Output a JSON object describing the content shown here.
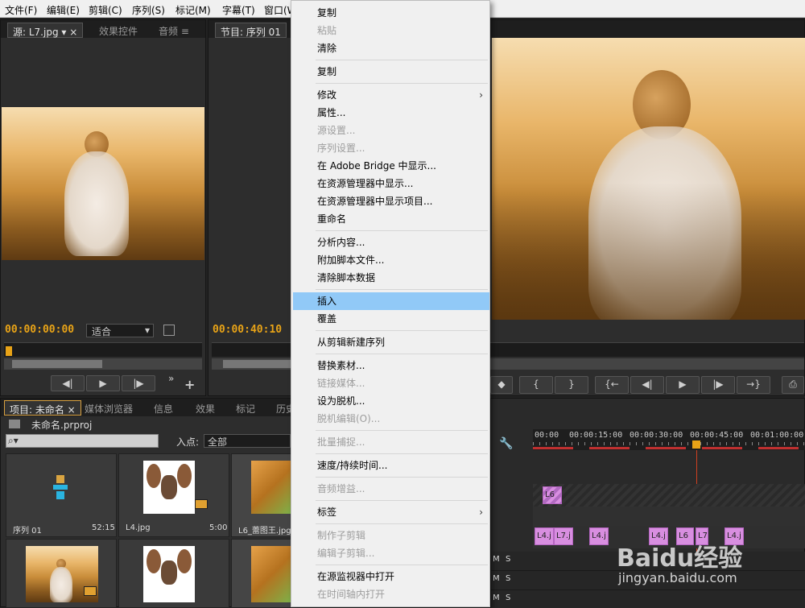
{
  "menubar": {
    "items": [
      "文件(F)",
      "编辑(E)",
      "剪辑(C)",
      "序列(S)",
      "标记(M)",
      "字幕(T)",
      "窗口(W"
    ]
  },
  "source_panel": {
    "tab_source": "源: L7.jpg",
    "tab_effects": "效果控件",
    "tab_audio": "音频",
    "timecode": "00:00:00:00",
    "fit": "适合"
  },
  "program_panel": {
    "tab": "节目: 序列 01",
    "timecode": "00:00:40:10",
    "buttons": [
      "{",
      "}",
      "{←",
      "◀|",
      "▶",
      "|▶",
      "→}"
    ]
  },
  "project_panel": {
    "tabs": [
      "项目: 未命名",
      "媒体浏览器",
      "信息",
      "效果",
      "标记",
      "历史"
    ],
    "project_name": "未命名.prproj",
    "in_point_label": "入点:",
    "in_point_value": "全部",
    "items": [
      {
        "name": "序列 01",
        "duration": "52:15"
      },
      {
        "name": "L4.jpg",
        "duration": "5:00"
      },
      {
        "name": "L6_蕾图王.jpg",
        "duration": ""
      }
    ]
  },
  "timeline": {
    "ruler": [
      "00:00",
      "00:00:15:00",
      "00:00:30:00",
      "00:00:45:00",
      "00:01:00:00"
    ],
    "clips_v2": [
      "L6"
    ],
    "clips_v1": [
      "L4.j",
      "L7.j",
      "L4.j",
      "L4.j",
      "L6",
      "L7",
      "L4.j"
    ],
    "track_letters": [
      "M",
      "S",
      "M",
      "S",
      "M",
      "S"
    ]
  },
  "context_menu": {
    "items": [
      {
        "label": "复制",
        "disabled": false
      },
      {
        "label": "粘贴",
        "disabled": true
      },
      {
        "label": "清除",
        "disabled": false
      },
      {
        "sep": true
      },
      {
        "label": "复制",
        "disabled": false
      },
      {
        "sep": true
      },
      {
        "label": "修改",
        "disabled": false,
        "submenu": true
      },
      {
        "label": "属性...",
        "disabled": false
      },
      {
        "label": "源设置...",
        "disabled": true
      },
      {
        "label": "序列设置...",
        "disabled": true
      },
      {
        "label": "在 Adobe Bridge 中显示...",
        "disabled": false
      },
      {
        "label": "在资源管理器中显示...",
        "disabled": false
      },
      {
        "label": "在资源管理器中显示项目...",
        "disabled": false
      },
      {
        "label": "重命名",
        "disabled": false
      },
      {
        "sep": true
      },
      {
        "label": "分析内容...",
        "disabled": false
      },
      {
        "label": "附加脚本文件...",
        "disabled": false
      },
      {
        "label": "清除脚本数据",
        "disabled": false
      },
      {
        "sep": true
      },
      {
        "label": "插入",
        "disabled": false,
        "highlight": true
      },
      {
        "label": "覆盖",
        "disabled": false
      },
      {
        "sep": true
      },
      {
        "label": "从剪辑新建序列",
        "disabled": false
      },
      {
        "sep": true
      },
      {
        "label": "替换素材...",
        "disabled": false
      },
      {
        "label": "链接媒体...",
        "disabled": true
      },
      {
        "label": "设为脱机...",
        "disabled": false
      },
      {
        "label": "脱机编辑(O)...",
        "disabled": true
      },
      {
        "sep": true
      },
      {
        "label": "批量捕捉...",
        "disabled": true
      },
      {
        "sep": true
      },
      {
        "label": "速度/持续时间...",
        "disabled": false
      },
      {
        "sep": true
      },
      {
        "label": "音频增益...",
        "disabled": true
      },
      {
        "sep": true
      },
      {
        "label": "标签",
        "disabled": false,
        "submenu": true
      },
      {
        "sep": true
      },
      {
        "label": "制作子剪辑",
        "disabled": true
      },
      {
        "label": "编辑子剪辑...",
        "disabled": true
      },
      {
        "sep": true
      },
      {
        "label": "在源监视器中打开",
        "disabled": false
      },
      {
        "label": "在时间轴内打开",
        "disabled": true
      }
    ]
  },
  "watermark": {
    "brand": "Baidu经验",
    "url": "jingyan.baidu.com"
  }
}
